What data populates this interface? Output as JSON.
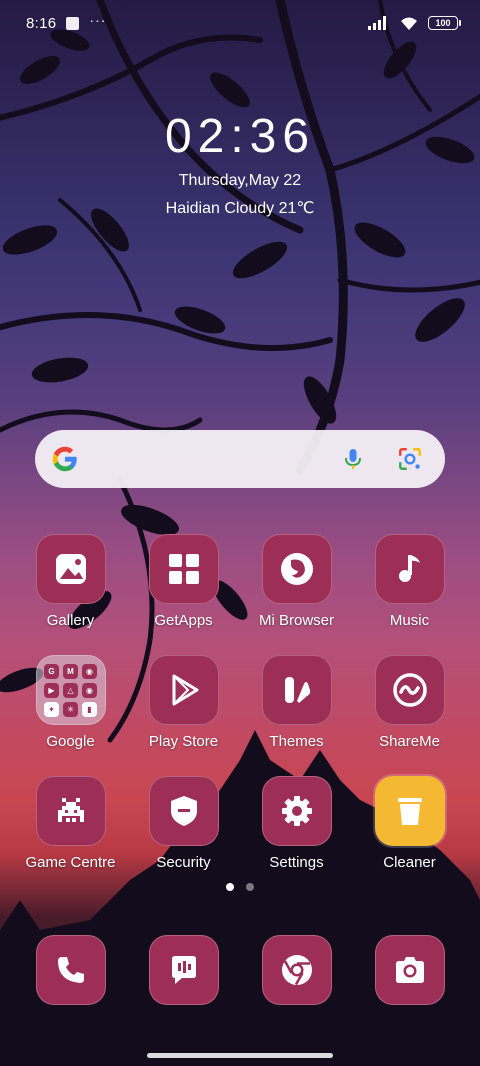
{
  "status_bar": {
    "time": "8:16",
    "more_dots": "···",
    "battery": "100"
  },
  "clock_widget": {
    "time": "02:36",
    "date": "Thursday,May 22",
    "weather": "Haidian Cloudy 21℃"
  },
  "colors": {
    "icon_bg": "#9d2f56",
    "cleaner_bg": "#f5b832"
  },
  "apps": [
    {
      "label": "Gallery",
      "icon": "gallery-icon"
    },
    {
      "label": "GetApps",
      "icon": "getapps-icon"
    },
    {
      "label": "Mi Browser",
      "icon": "browser-icon"
    },
    {
      "label": "Music",
      "icon": "music-icon"
    },
    {
      "label": "Google",
      "icon": "google-folder-icon"
    },
    {
      "label": "Play Store",
      "icon": "play-store-icon"
    },
    {
      "label": "Themes",
      "icon": "themes-icon"
    },
    {
      "label": "ShareMe",
      "icon": "shareme-icon"
    },
    {
      "label": "Game Centre",
      "icon": "game-centre-icon"
    },
    {
      "label": "Security",
      "icon": "security-icon"
    },
    {
      "label": "Settings",
      "icon": "settings-icon"
    },
    {
      "label": "Cleaner",
      "icon": "cleaner-icon"
    }
  ],
  "dock": [
    {
      "icon": "phone-icon"
    },
    {
      "icon": "messages-icon"
    },
    {
      "icon": "chrome-icon"
    },
    {
      "icon": "camera-icon"
    }
  ],
  "page_indicator": {
    "pages": 2,
    "current": 1
  }
}
